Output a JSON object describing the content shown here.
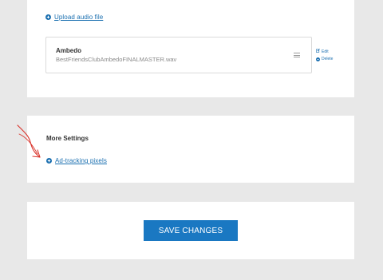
{
  "audio_section": {
    "upload_link_label": "Upload audio file",
    "item": {
      "title": "Ambedo",
      "filename": "BestFriendsClubAmbedoFINALMASTER.wav"
    },
    "edit_label": "Edit",
    "delete_label": "Delete"
  },
  "more_settings": {
    "title": "More Settings",
    "link_label": "Ad-tracking pixels"
  },
  "footer": {
    "save_label": "SAVE CHANGES"
  },
  "colors": {
    "accent": "#1a78c2",
    "link": "#1a6fb0",
    "background": "#e8e8e8",
    "annotation": "#d9332b"
  },
  "icons": {
    "upload": "plus-circle-icon",
    "drag": "drag-handle-icon",
    "edit": "edit-icon",
    "delete": "minus-circle-icon",
    "adtracking": "plus-circle-icon"
  }
}
